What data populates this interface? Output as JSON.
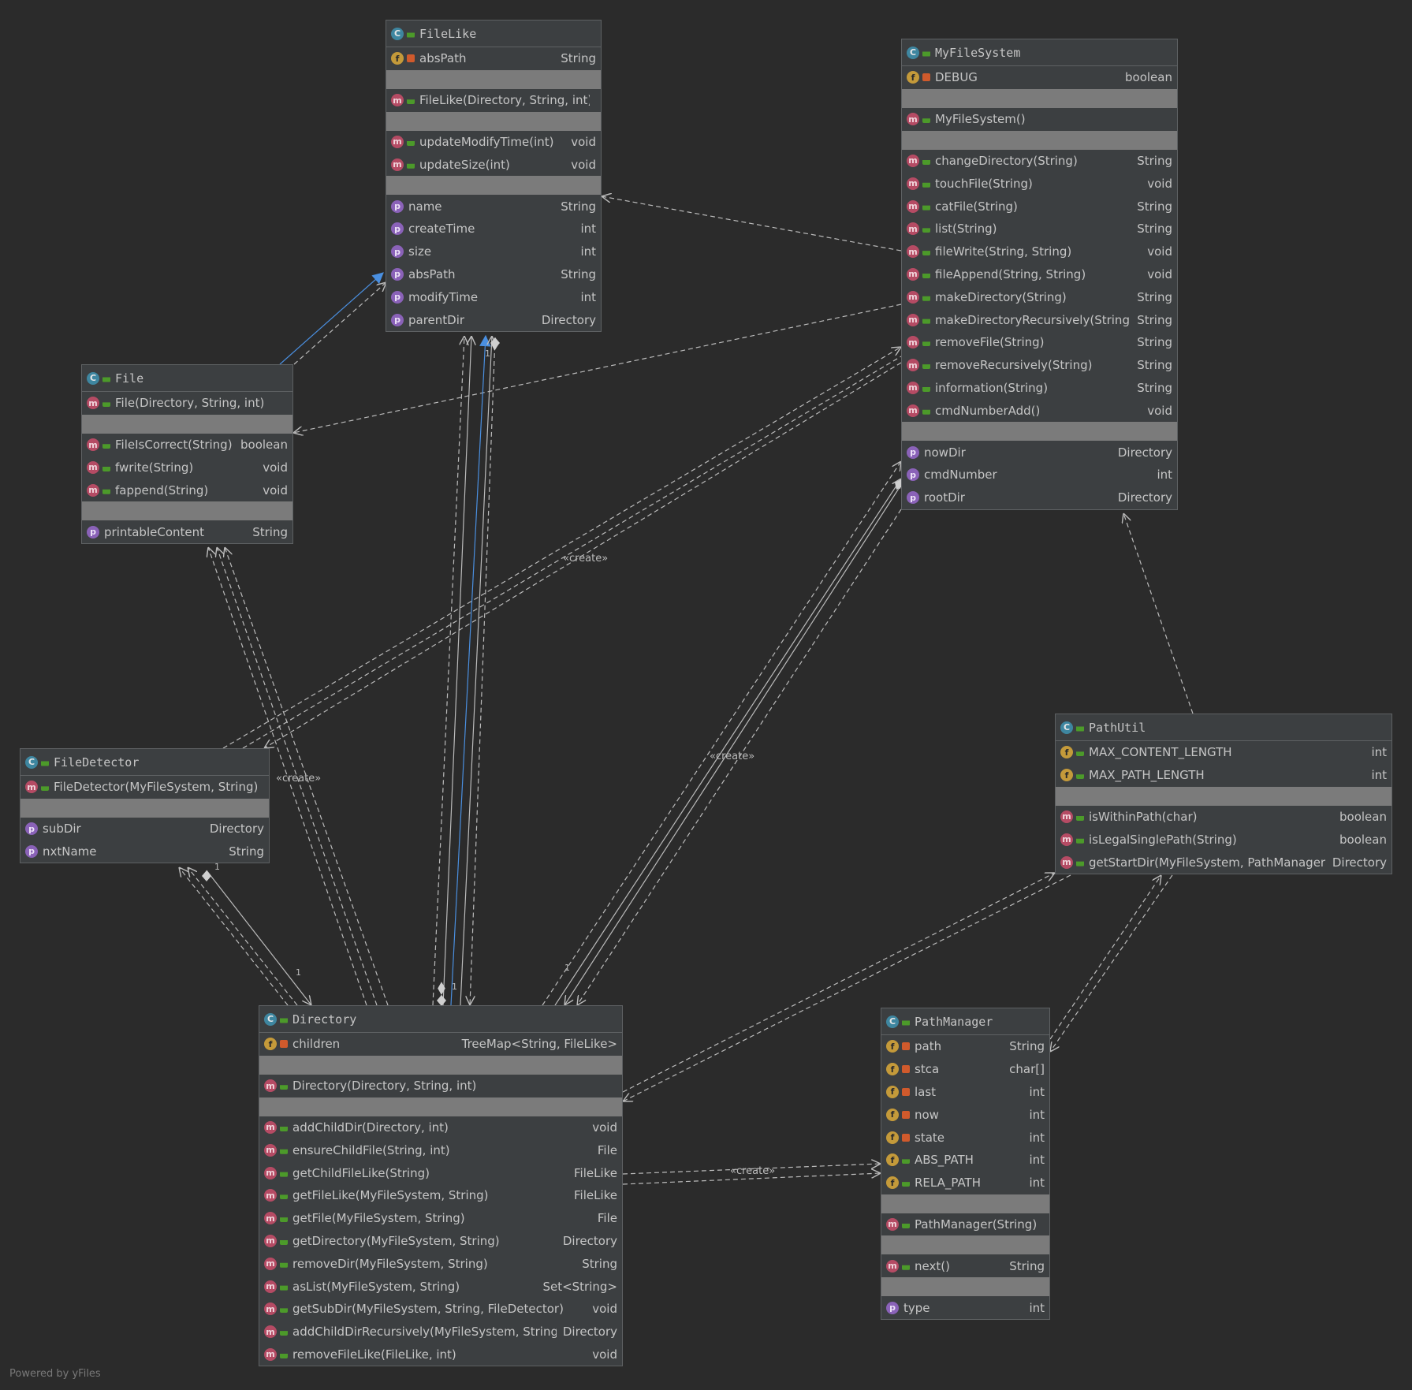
{
  "footer": "Powered by yFiles",
  "labels": {
    "create": "«create»",
    "one": "1"
  },
  "icons": {
    "class": "C",
    "field": "f",
    "method": "m",
    "property": "p"
  },
  "classes": {
    "FileLike": {
      "title": "FileLike",
      "rows": [
        {
          "k": "f",
          "v": "priv",
          "n": "absPath",
          "t": "String"
        },
        {
          "sep": true
        },
        {
          "k": "m",
          "v": "pub",
          "n": "FileLike(Directory, String, int)",
          "t": ""
        },
        {
          "sep": true
        },
        {
          "k": "m",
          "v": "pub",
          "n": "updateModifyTime(int)",
          "t": "void"
        },
        {
          "k": "m",
          "v": "pub",
          "n": "updateSize(int)",
          "t": "void"
        },
        {
          "sep": true
        },
        {
          "k": "p",
          "v": "",
          "n": "name",
          "t": "String"
        },
        {
          "k": "p",
          "v": "",
          "n": "createTime",
          "t": "int"
        },
        {
          "k": "p",
          "v": "",
          "n": "size",
          "t": "int"
        },
        {
          "k": "p",
          "v": "",
          "n": "absPath",
          "t": "String"
        },
        {
          "k": "p",
          "v": "",
          "n": "modifyTime",
          "t": "int"
        },
        {
          "k": "p",
          "v": "",
          "n": "parentDir",
          "t": "Directory"
        }
      ]
    },
    "MyFileSystem": {
      "title": "MyFileSystem",
      "rows": [
        {
          "k": "f",
          "v": "priv",
          "n": "DEBUG",
          "t": "boolean"
        },
        {
          "sep": true
        },
        {
          "k": "m",
          "v": "pub",
          "n": "MyFileSystem()",
          "t": ""
        },
        {
          "sep": true
        },
        {
          "k": "m",
          "v": "pub",
          "n": "changeDirectory(String)",
          "t": "String"
        },
        {
          "k": "m",
          "v": "pub",
          "n": "touchFile(String)",
          "t": "void"
        },
        {
          "k": "m",
          "v": "pub",
          "n": "catFile(String)",
          "t": "String"
        },
        {
          "k": "m",
          "v": "pub",
          "n": "list(String)",
          "t": "String"
        },
        {
          "k": "m",
          "v": "pub",
          "n": "fileWrite(String, String)",
          "t": "void"
        },
        {
          "k": "m",
          "v": "pub",
          "n": "fileAppend(String, String)",
          "t": "void"
        },
        {
          "k": "m",
          "v": "pub",
          "n": "makeDirectory(String)",
          "t": "String"
        },
        {
          "k": "m",
          "v": "pub",
          "n": "makeDirectoryRecursively(String)",
          "t": "String"
        },
        {
          "k": "m",
          "v": "pub",
          "n": "removeFile(String)",
          "t": "String"
        },
        {
          "k": "m",
          "v": "pub",
          "n": "removeRecursively(String)",
          "t": "String"
        },
        {
          "k": "m",
          "v": "pub",
          "n": "information(String)",
          "t": "String"
        },
        {
          "k": "m",
          "v": "pub",
          "n": "cmdNumberAdd()",
          "t": "void"
        },
        {
          "sep": true
        },
        {
          "k": "p",
          "v": "",
          "n": "nowDir",
          "t": "Directory"
        },
        {
          "k": "p",
          "v": "",
          "n": "cmdNumber",
          "t": "int"
        },
        {
          "k": "p",
          "v": "",
          "n": "rootDir",
          "t": "Directory"
        }
      ]
    },
    "File": {
      "title": "File",
      "rows": [
        {
          "k": "m",
          "v": "pub",
          "n": "File(Directory, String, int)",
          "t": ""
        },
        {
          "sep": true
        },
        {
          "k": "m",
          "v": "pub",
          "n": "FileIsCorrect(String)",
          "t": "boolean"
        },
        {
          "k": "m",
          "v": "pub",
          "n": "fwrite(String)",
          "t": "void"
        },
        {
          "k": "m",
          "v": "pub",
          "n": "fappend(String)",
          "t": "void"
        },
        {
          "sep": true
        },
        {
          "k": "p",
          "v": "",
          "n": "printableContent",
          "t": "String"
        }
      ]
    },
    "FileDetector": {
      "title": "FileDetector",
      "rows": [
        {
          "k": "m",
          "v": "pub",
          "n": "FileDetector(MyFileSystem, String)",
          "t": ""
        },
        {
          "sep": true
        },
        {
          "k": "p",
          "v": "",
          "n": "subDir",
          "t": "Directory"
        },
        {
          "k": "p",
          "v": "",
          "n": "nxtName",
          "t": "String"
        }
      ]
    },
    "PathUtil": {
      "title": "PathUtil",
      "rows": [
        {
          "k": "f",
          "v": "pub",
          "n": "MAX_CONTENT_LENGTH",
          "t": "int"
        },
        {
          "k": "f",
          "v": "pub",
          "n": "MAX_PATH_LENGTH",
          "t": "int"
        },
        {
          "sep": true
        },
        {
          "k": "m",
          "v": "pub",
          "n": "isWithinPath(char)",
          "t": "boolean"
        },
        {
          "k": "m",
          "v": "pub",
          "n": "isLegalSinglePath(String)",
          "t": "boolean"
        },
        {
          "k": "m",
          "v": "pub",
          "n": "getStartDir(MyFileSystem, PathManager)",
          "t": "Directory"
        }
      ]
    },
    "Directory": {
      "title": "Directory",
      "rows": [
        {
          "k": "f",
          "v": "priv",
          "n": "children",
          "t": "TreeMap<String, FileLike>"
        },
        {
          "sep": true
        },
        {
          "k": "m",
          "v": "pub",
          "n": "Directory(Directory, String, int)",
          "t": ""
        },
        {
          "sep": true
        },
        {
          "k": "m",
          "v": "pub",
          "n": "addChildDir(Directory, int)",
          "t": "void"
        },
        {
          "k": "m",
          "v": "pub",
          "n": "ensureChildFile(String, int)",
          "t": "File"
        },
        {
          "k": "m",
          "v": "pub",
          "n": "getChildFileLike(String)",
          "t": "FileLike"
        },
        {
          "k": "m",
          "v": "pub",
          "n": "getFileLike(MyFileSystem, String)",
          "t": "FileLike"
        },
        {
          "k": "m",
          "v": "pub",
          "n": "getFile(MyFileSystem, String)",
          "t": "File"
        },
        {
          "k": "m",
          "v": "pub",
          "n": "getDirectory(MyFileSystem, String)",
          "t": "Directory"
        },
        {
          "k": "m",
          "v": "pub",
          "n": "removeDir(MyFileSystem, String)",
          "t": "String"
        },
        {
          "k": "m",
          "v": "pub",
          "n": "asList(MyFileSystem, String)",
          "t": "Set<String>"
        },
        {
          "k": "m",
          "v": "pub",
          "n": "getSubDir(MyFileSystem, String, FileDetector)",
          "t": "void"
        },
        {
          "k": "m",
          "v": "pub",
          "n": "addChildDirRecursively(MyFileSystem, String)",
          "t": "Directory"
        },
        {
          "k": "m",
          "v": "pub",
          "n": "removeFileLike(FileLike, int)",
          "t": "void"
        }
      ]
    },
    "PathManager": {
      "title": "PathManager",
      "rows": [
        {
          "k": "f",
          "v": "priv",
          "n": "path",
          "t": "String"
        },
        {
          "k": "f",
          "v": "priv",
          "n": "stca",
          "t": "char[]"
        },
        {
          "k": "f",
          "v": "priv",
          "n": "last",
          "t": "int"
        },
        {
          "k": "f",
          "v": "priv",
          "n": "now",
          "t": "int"
        },
        {
          "k": "f",
          "v": "priv",
          "n": "state",
          "t": "int"
        },
        {
          "k": "f",
          "v": "pub",
          "n": "ABS_PATH",
          "t": "int"
        },
        {
          "k": "f",
          "v": "pub",
          "n": "RELA_PATH",
          "t": "int"
        },
        {
          "sep": true
        },
        {
          "k": "m",
          "v": "pub",
          "n": "PathManager(String)",
          "t": ""
        },
        {
          "sep": true
        },
        {
          "k": "m",
          "v": "pub",
          "n": "next()",
          "t": "String"
        },
        {
          "sep": true
        },
        {
          "k": "p",
          "v": "",
          "n": "type",
          "t": "int"
        }
      ]
    }
  }
}
